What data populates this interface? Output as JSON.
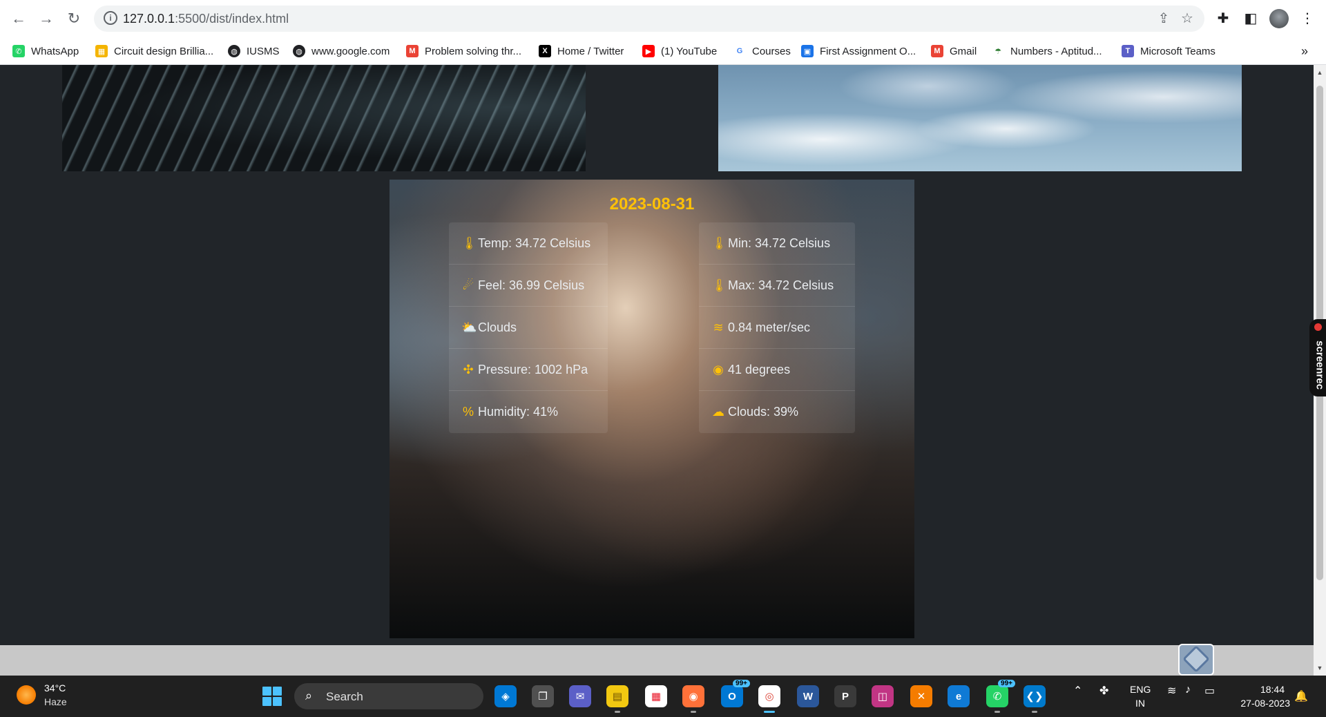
{
  "browser": {
    "url_host": "127.0.0.1",
    "url_path": ":5500/dist/index.html",
    "bookmarks": [
      {
        "label": "WhatsApp",
        "color": "#25d366",
        "glyph": "✆"
      },
      {
        "label": "Circuit design Brillia...",
        "color": "#f4b400",
        "glyph": "▦"
      },
      {
        "label": "IUSMS",
        "color": "#202124",
        "glyph": "◍"
      },
      {
        "label": "www.google.com",
        "color": "#202124",
        "glyph": "◍"
      },
      {
        "label": "Problem solving thr...",
        "color": "#ea4335",
        "glyph": "M"
      },
      {
        "label": "Home / Twitter",
        "color": "#000000",
        "glyph": "X"
      },
      {
        "label": "(1) YouTube",
        "color": "#ff0000",
        "glyph": "▶"
      },
      {
        "label": "Courses",
        "color": "#4285f4",
        "glyph": "G"
      },
      {
        "label": "First Assignment O...",
        "color": "#1a73e8",
        "glyph": "▣"
      },
      {
        "label": "Gmail",
        "color": "#ea4335",
        "glyph": "M"
      },
      {
        "label": "Numbers - Aptitud...",
        "color": "#2e7d32",
        "glyph": "☂"
      },
      {
        "label": "Microsoft Teams",
        "color": "#5b5fc7",
        "glyph": "T"
      }
    ],
    "more": "»"
  },
  "card": {
    "date": "2023-08-31",
    "left": [
      {
        "icon": "🌡",
        "text": "Temp: 34.72 Celsius"
      },
      {
        "icon": "☄",
        "text": "Feel: 36.99 Celsius"
      },
      {
        "icon": "⛅",
        "text": "Clouds"
      },
      {
        "icon": "✣",
        "text": "Pressure: 1002 hPa"
      },
      {
        "icon": "%",
        "text": "Humidity: 41%"
      }
    ],
    "right": [
      {
        "icon": "🌡",
        "text": "Min: 34.72 Celsius"
      },
      {
        "icon": "🌡",
        "text": "Max: 34.72 Celsius"
      },
      {
        "icon": "≋",
        "text": "0.84 meter/sec"
      },
      {
        "icon": "◉",
        "text": "41 degrees"
      },
      {
        "icon": "☁",
        "text": "Clouds: 39%"
      }
    ]
  },
  "screenrec": "screenrec",
  "taskbar": {
    "temp": "34°C",
    "condition": "Haze",
    "search": "Search",
    "badge_mail": "99+",
    "badge_whatsapp": "99+",
    "lang1": "ENG",
    "lang2": "IN",
    "time": "18:44",
    "date": "27-08-2023"
  }
}
